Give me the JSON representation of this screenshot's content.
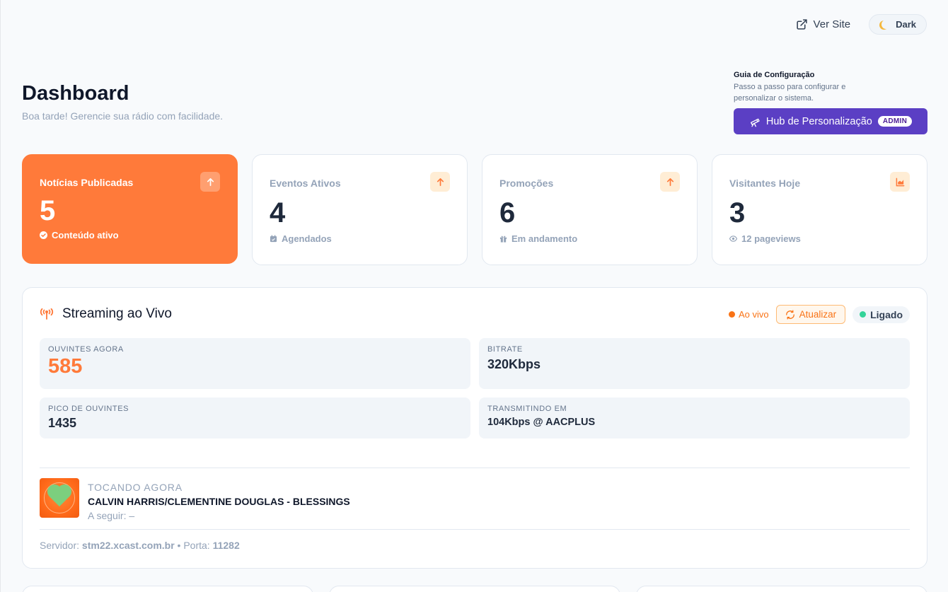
{
  "topbar": {
    "ver_site": "Ver Site",
    "dark": "Dark"
  },
  "header": {
    "title": "Dashboard",
    "subtitle": "Boa tarde! Gerencie sua rádio com facilidade."
  },
  "guide": {
    "title": "Guia de Configuração",
    "desc": "Passo a passo para configurar e personalizar o sistema.",
    "button": "Hub de Personalização",
    "badge": "ADMIN"
  },
  "cards": [
    {
      "label": "Notícias Publicadas",
      "value": "5",
      "foot": "Conteúdo ativo"
    },
    {
      "label": "Eventos Ativos",
      "value": "4",
      "foot": "Agendados"
    },
    {
      "label": "Promoções",
      "value": "6",
      "foot": "Em andamento"
    },
    {
      "label": "Visitantes Hoje",
      "value": "3",
      "foot": "12 pageviews"
    }
  ],
  "stream": {
    "title": "Streaming ao Vivo",
    "live": "Ao vivo",
    "refresh": "Atualizar",
    "status": "Ligado",
    "metrics": {
      "listeners": {
        "label": "OUVINTES AGORA",
        "value": "585"
      },
      "bitrate": {
        "label": "BITRATE",
        "value": "320Kbps"
      },
      "peak": {
        "label": "PICO DE OUVINTES",
        "value": "1435"
      },
      "transmitting": {
        "label": "TRANSMITINDO EM",
        "value": "104Kbps @ AACPLUS"
      }
    },
    "now_playing": {
      "label": "TOCANDO AGORA",
      "track": "CALVIN HARRIS/CLEMENTINE DOUGLAS - BLESSINGS",
      "next": "A seguir: –"
    },
    "server": {
      "server_label": "Servidor:",
      "server_value": "stm22.xcast.com.br",
      "port_label": "• Porta:",
      "port_value": "11282"
    }
  },
  "colors": {
    "accent": "#ff7a3a",
    "purple": "#5b3fc4",
    "online": "#34d399",
    "live": "#f97316"
  }
}
